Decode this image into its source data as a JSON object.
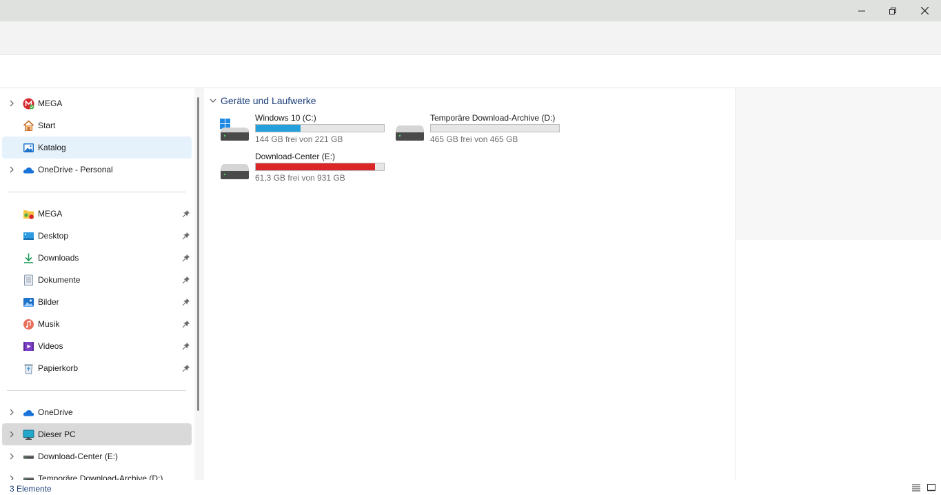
{
  "window": {
    "controls": [
      "minimize-icon",
      "restore-icon",
      "close-icon"
    ]
  },
  "sidebar": {
    "top_items": [
      {
        "label": "MEGA",
        "icon": "mega-icon",
        "has_chevron": true
      },
      {
        "label": "Start",
        "icon": "home-icon",
        "has_chevron": false
      },
      {
        "label": "Katalog",
        "icon": "gallery-icon",
        "has_chevron": false,
        "selected": true
      },
      {
        "label": "OneDrive - Personal",
        "icon": "cloud-icon",
        "has_chevron": true
      }
    ],
    "pinned_items": [
      {
        "label": "MEGA",
        "icon": "mega-folder-icon"
      },
      {
        "label": "Desktop",
        "icon": "desktop-icon"
      },
      {
        "label": "Downloads",
        "icon": "download-icon"
      },
      {
        "label": "Dokumente",
        "icon": "document-icon"
      },
      {
        "label": "Bilder",
        "icon": "pictures-icon"
      },
      {
        "label": "Musik",
        "icon": "music-icon"
      },
      {
        "label": "Videos",
        "icon": "videos-icon"
      },
      {
        "label": "Papierkorb",
        "icon": "recycle-bin-icon"
      }
    ],
    "bottom_items": [
      {
        "label": "OneDrive",
        "icon": "cloud-icon"
      },
      {
        "label": "Dieser PC",
        "icon": "monitor-icon",
        "active": true
      },
      {
        "label": "Download-Center (E:)",
        "icon": "drive-icon"
      },
      {
        "label": "Temporäre Download-Archive (D:)",
        "icon": "drive-icon"
      }
    ]
  },
  "content": {
    "group_title": "Geräte und Laufwerke",
    "drives": [
      {
        "name": "Windows 10 (C:)",
        "free_text": "144 GB frei von 221 GB",
        "used_fraction": 0.35,
        "bar_color": "#26a0da",
        "windows_logo": true
      },
      {
        "name": "Temporäre Download-Archive (D:)",
        "free_text": "465 GB frei von 465 GB",
        "used_fraction": 0.0,
        "bar_color": "#26a0da",
        "windows_logo": false
      },
      {
        "name": "Download-Center (E:)",
        "free_text": "61,3 GB frei von 931 GB",
        "used_fraction": 0.93,
        "bar_color": "#da2626",
        "windows_logo": false
      }
    ]
  },
  "statusbar": {
    "item_count": "3 Elemente",
    "view_buttons": [
      "details-view-icon",
      "large-icons-view-icon"
    ]
  }
}
